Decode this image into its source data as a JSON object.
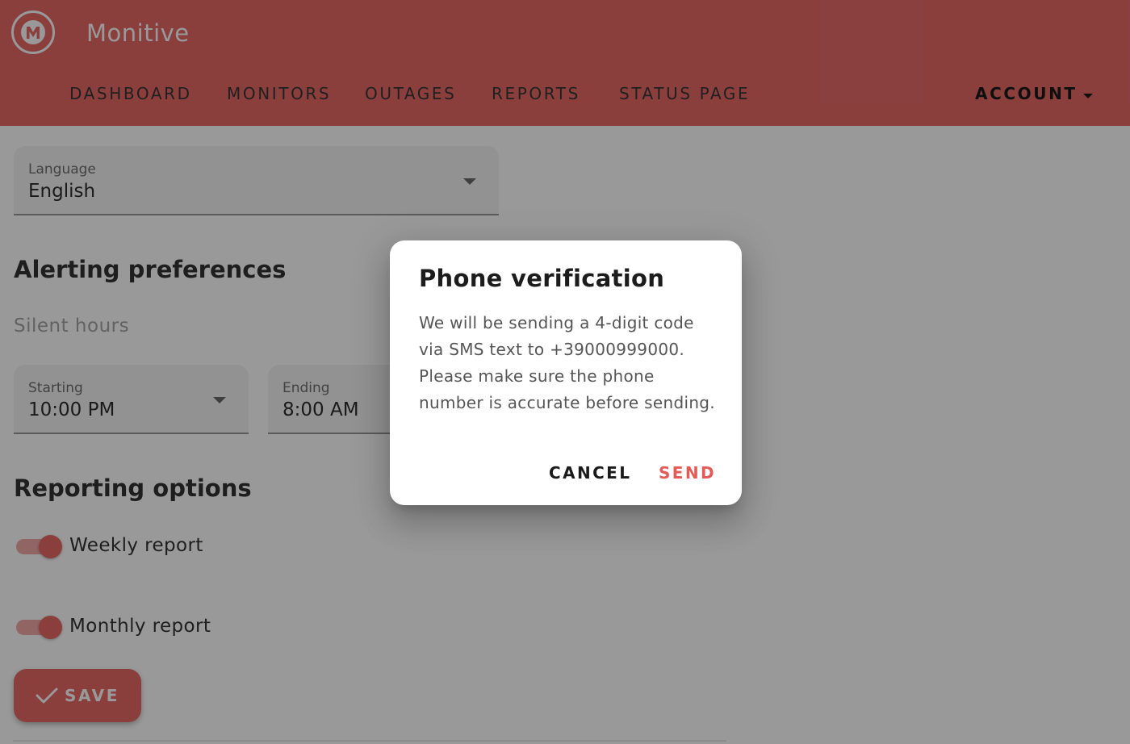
{
  "app": {
    "title": "Monitive",
    "logo_icon": "m-logo-icon"
  },
  "colors": {
    "brand": "#e35a56",
    "brand_light": "#f0a09e",
    "scrim": "rgba(33,33,33,0.46)"
  },
  "nav": {
    "items": [
      {
        "label": "DASHBOARD"
      },
      {
        "label": "MONITORS"
      },
      {
        "label": "OUTAGES"
      },
      {
        "label": "REPORTS"
      },
      {
        "label": "STATUS PAGE"
      }
    ],
    "account_label": "ACCOUNT"
  },
  "language": {
    "label": "Language",
    "value": "English"
  },
  "alerting": {
    "title": "Alerting preferences",
    "silent_hours_label": "Silent hours",
    "starting": {
      "label": "Starting",
      "value": "10:00 PM"
    },
    "ending": {
      "label": "Ending",
      "value": "8:00 AM"
    }
  },
  "reporting": {
    "title": "Reporting options",
    "weekly": {
      "label": "Weekly report",
      "enabled": true
    },
    "monthly": {
      "label": "Monthly report",
      "enabled": true
    }
  },
  "save_label": "SAVE",
  "dialog": {
    "title": "Phone verification",
    "body": "We will be sending a 4-digit code via SMS text to +39000999000. Please make sure the phone number is accurate before sending.",
    "cancel_label": "CANCEL",
    "send_label": "SEND"
  }
}
